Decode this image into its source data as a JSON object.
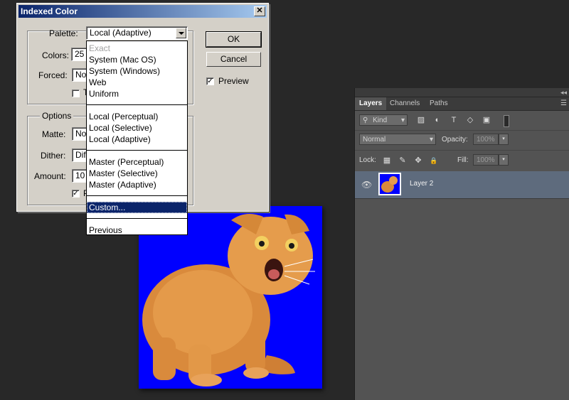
{
  "dialog": {
    "title": "Indexed Color",
    "close_glyph": "✕",
    "palette_label": "Palette:",
    "palette_value": "Local (Adaptive)",
    "colors_label": "Colors:",
    "colors_value": "25",
    "forced_label": "Forced:",
    "forced_value": "No",
    "transparency_glyph": "T",
    "options_legend": "Options",
    "matte_label": "Matte:",
    "matte_value": "No",
    "dither_label": "Dither:",
    "dither_value": "Dif",
    "amount_label": "Amount:",
    "amount_value": "10",
    "preserve_glyph": "P",
    "ok_label": "OK",
    "cancel_label": "Cancel",
    "preview_label": "Preview",
    "preview_checked": "✓",
    "check_mark": "✓"
  },
  "palette_options": {
    "exact": "Exact",
    "system_mac": "System (Mac OS)",
    "system_windows": "System (Windows)",
    "web": "Web",
    "uniform": "Uniform",
    "local_perceptual": "Local (Perceptual)",
    "local_selective": "Local (Selective)",
    "local_adaptive": "Local (Adaptive)",
    "master_perceptual": "Master (Perceptual)",
    "master_selective": "Master (Selective)",
    "master_adaptive": "Master (Adaptive)",
    "custom": "Custom...",
    "previous": "Previous"
  },
  "layers_panel": {
    "tabs": [
      "Layers",
      "Channels",
      "Paths"
    ],
    "kind_label": "Kind",
    "blend_mode": "Normal",
    "opacity_label": "Opacity:",
    "opacity_value": "100%",
    "lock_label": "Lock:",
    "fill_label": "Fill:",
    "fill_value": "100%",
    "layer_name": "Layer 2"
  },
  "colors": {
    "canvas_background": "#0000ff",
    "selection": "#0a246a",
    "layer_selected": "#5e6b7d"
  },
  "icons": {
    "search": "⚲",
    "image_filter": "▨",
    "adjust_filter": "◐",
    "type_filter": "T",
    "shape_filter": "◇",
    "smart_filter": "▣",
    "lock_pixels": "▦",
    "lock_paint": "✎",
    "lock_move": "✥",
    "lock_all": "🔒",
    "eye": "👁",
    "panel_menu": "☰",
    "collapse": "◂◂",
    "chevron": "▾"
  }
}
